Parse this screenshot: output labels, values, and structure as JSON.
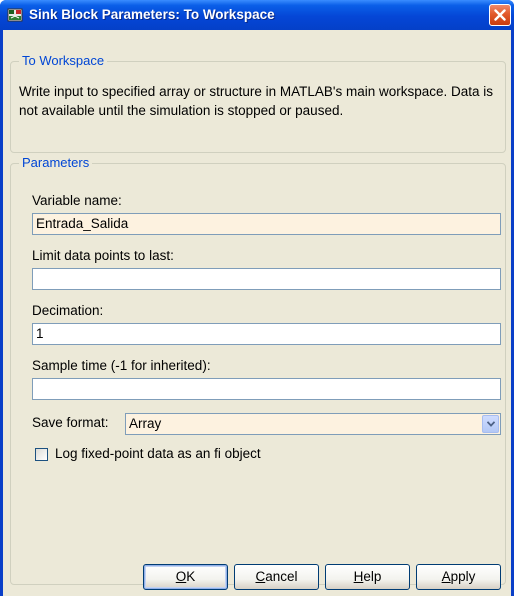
{
  "window": {
    "title": "Sink Block Parameters: To Workspace"
  },
  "block_group": {
    "legend": "To Workspace",
    "description": "Write input to specified array or structure in MATLAB's main workspace. Data is not available until the simulation is stopped or paused."
  },
  "parameters": {
    "legend": "Parameters",
    "variable_name": {
      "label": "Variable name:",
      "value": "Entrada_Salida"
    },
    "limit_points": {
      "label": "Limit data points to last:",
      "value": ""
    },
    "decimation": {
      "label": "Decimation:",
      "value": "1"
    },
    "sample_time": {
      "label": "Sample time (-1 for inherited):",
      "value": ""
    },
    "save_format": {
      "label": "Save format:",
      "selected": "Array"
    },
    "log_fixed_point": {
      "label": "Log fixed-point data as an fi object",
      "checked": false
    }
  },
  "buttons": {
    "ok": {
      "accel": "O",
      "rest": "K"
    },
    "cancel": {
      "accel": "C",
      "rest": "ancel"
    },
    "help": {
      "accel": "H",
      "rest": "elp"
    },
    "apply": {
      "accel": "A",
      "rest": "pply"
    }
  },
  "icons": {
    "window": "simulink-block-icon",
    "close": "close-icon",
    "dropdown": "chevron-down-icon"
  },
  "colors": {
    "titlebar": "#0546d6",
    "dialog_bg": "#ece9d8",
    "legend_text": "#0046d5",
    "modified_field": "#fdf2e0",
    "close_button": "#e25a2c"
  }
}
